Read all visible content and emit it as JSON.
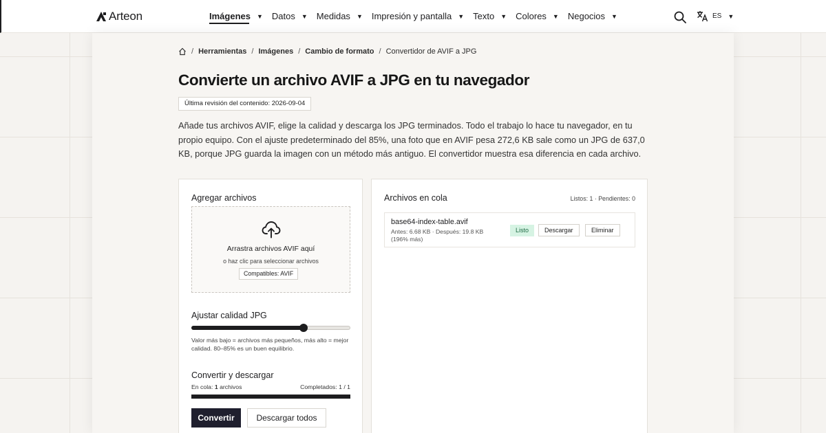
{
  "header": {
    "brand": "Arteon",
    "nav": [
      {
        "label": "Imágenes",
        "active": true
      },
      {
        "label": "Datos"
      },
      {
        "label": "Medidas"
      },
      {
        "label": "Impresión y pantalla"
      },
      {
        "label": "Texto"
      },
      {
        "label": "Colores"
      },
      {
        "label": "Negocios"
      }
    ],
    "language": "ES",
    "caret": "▼"
  },
  "breadcrumb": {
    "home_icon": "home-icon",
    "items": [
      "Herramientas",
      "Imágenes",
      "Cambio de formato"
    ],
    "current": "Convertidor de AVIF a JPG",
    "separator": "/"
  },
  "page": {
    "title": "Convierte un archivo AVIF a JPG en tu navegador",
    "revision": "Última revisión del contenido: 2026-09-04",
    "intro": "Añade tus archivos AVIF, elige la calidad y descarga los JPG terminados. Todo el trabajo lo hace tu navegador, en tu propio equipo. Con el ajuste predeterminado del 85%, una foto que en AVIF pesa 272,6 KB sale como un JPG de 637,0 KB, porque JPG guarda la imagen con un método más antiguo. El convertidor muestra esa diferencia en cada archivo."
  },
  "upload": {
    "title": "Agregar archivos",
    "drop_main": "Arrastra archivos AVIF aquí",
    "drop_sub": "o haz clic para seleccionar archivos",
    "compat": "Compatibles: AVIF",
    "icon": "cloud-upload-icon"
  },
  "quality": {
    "title": "Ajustar calidad JPG",
    "value_fraction": 0.705,
    "help": "Valor más bajo = archivos más pequeños, más alto = mejor calidad. 80–85% es un buen equilibrio."
  },
  "convert": {
    "title": "Convertir y descargar",
    "queue_prefix": "En cola: ",
    "queue_count": "1",
    "queue_suffix": " archivos",
    "completed": "Completados: 1 / 1",
    "progress_fraction": 1.0,
    "convert_label": "Convertir",
    "download_all_label": "Descargar todos"
  },
  "queue": {
    "title": "Archivos en cola",
    "stats": "Listos: 1 · Pendientes: 0",
    "files": [
      {
        "name": "base64-index-table.avif",
        "meta": "Antes: 6.68 KB · Después: 19.8 KB (196% más)",
        "status": "Listo",
        "download_label": "Descargar",
        "remove_label": "Eliminar"
      }
    ]
  },
  "colors": {
    "accent": "#1d1d1f",
    "primary_button": "#1f1f2e",
    "status_done_bg": "#d6f3e3",
    "status_done_text": "#1f6b45"
  }
}
